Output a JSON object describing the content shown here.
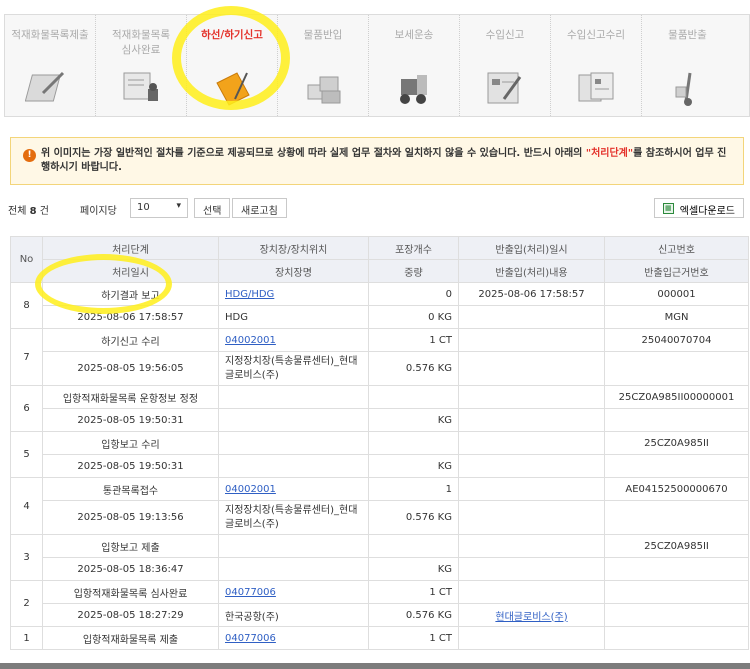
{
  "steps": [
    {
      "label": "적재화물목록제출",
      "icon": "clipboard-pencil-icon",
      "active": false
    },
    {
      "label": "적재화물목록\n심사완료",
      "icon": "document-stamp-icon",
      "active": false
    },
    {
      "label": "하선/하기신고",
      "icon": "folder-document-icon",
      "active": true
    },
    {
      "label": "물품반입",
      "icon": "boxes-stack-icon",
      "active": false
    },
    {
      "label": "보세운송",
      "icon": "forklift-icon",
      "active": false
    },
    {
      "label": "수입신고",
      "icon": "form-pen-icon",
      "active": false
    },
    {
      "label": "수입신고수리",
      "icon": "approved-form-icon",
      "active": false
    },
    {
      "label": "물품반출",
      "icon": "hand-truck-icon",
      "active": false
    }
  ],
  "notice": {
    "prefix": "위 이미지는 가장 일반적인 절차를 기준으로 제공되므로 상황에 따라 실제 업무 절차와 일치하지 않을 수 있습니다. 반드시 아래의 ",
    "emphasis": "\"처리단계\"",
    "suffix": "를 참조하시어 업무 진행하시기 바랍니다."
  },
  "toolbar": {
    "total_prefix": "전체",
    "total_count": "8",
    "total_suffix": "건",
    "per_page_label": "페이지당",
    "per_page_value": "10",
    "select_button": "선택",
    "refresh_button": "새로고침",
    "excel_button": "엑셀다운로드"
  },
  "table": {
    "headers": {
      "no": "No",
      "row1": [
        "처리단계",
        "장치장/장치위치",
        "포장개수",
        "반출입(처리)일시",
        "신고번호"
      ],
      "row2": [
        "처리일시",
        "장치장명",
        "중량",
        "반출입(처리)내용",
        "반출입근거번호"
      ]
    },
    "records": [
      {
        "no": "8",
        "step": "하기결과 보고",
        "location": "HDG/HDG",
        "count": "0",
        "io_time": "2025-08-06 17:58:57",
        "report_no": "000001",
        "time": "2025-08-06 17:58:57",
        "place": "HDG",
        "weight": "0 KG",
        "io_content": "",
        "basis_no": "MGN"
      },
      {
        "no": "7",
        "step": "하기신고 수리",
        "location": "04002001",
        "count": "1 CT",
        "io_time": "",
        "report_no": "25040070704",
        "time": "2025-08-05 19:56:05",
        "place": "지정장치장(특송물류센터)_현대\n글로비스(주)",
        "weight": "0.576 KG",
        "io_content": "",
        "basis_no": ""
      },
      {
        "no": "6",
        "step": "입항적재화물목록 운항정보 정정",
        "location": "",
        "count": "",
        "io_time": "",
        "report_no": "25CZ0A985II00000001",
        "time": "2025-08-05 19:50:31",
        "place": "",
        "weight": "KG",
        "io_content": "",
        "basis_no": ""
      },
      {
        "no": "5",
        "step": "입항보고 수리",
        "location": "",
        "count": "",
        "io_time": "",
        "report_no": "25CZ0A985II",
        "time": "2025-08-05 19:50:31",
        "place": "",
        "weight": "KG",
        "io_content": "",
        "basis_no": ""
      },
      {
        "no": "4",
        "step": "통관목록접수",
        "location": "04002001",
        "count": "1",
        "io_time": "",
        "report_no": "AE04152500000670",
        "time": "2025-08-05 19:13:56",
        "place": "지정장치장(특송물류센터)_현대\n글로비스(주)",
        "weight": "0.576 KG",
        "io_content": "",
        "basis_no": ""
      },
      {
        "no": "3",
        "step": "입항보고 제출",
        "location": "",
        "count": "",
        "io_time": "",
        "report_no": "25CZ0A985II",
        "time": "2025-08-05 18:36:47",
        "place": "",
        "weight": "KG",
        "io_content": "",
        "basis_no": ""
      },
      {
        "no": "2",
        "step": "입항적재화물목록 심사완료",
        "location": "04077006",
        "count": "1 CT",
        "io_time": "",
        "report_no": "",
        "time": "2025-08-05 18:27:29",
        "place": "한국공항(주)",
        "weight": "0.576 KG",
        "io_content": "현대글로비스(주)",
        "basis_no": ""
      },
      {
        "no": "1",
        "step": "입항적재화물목록 제출",
        "location": "04077006",
        "count": "1 CT",
        "io_time": "",
        "report_no": "",
        "time": "",
        "place": "",
        "weight": "",
        "io_content": "",
        "basis_no": ""
      }
    ]
  },
  "colors": {
    "active_step": "#e4322b",
    "highlight": "#ffef1a",
    "link": "#2f5fc4",
    "header_bg": "#eef0f5"
  }
}
